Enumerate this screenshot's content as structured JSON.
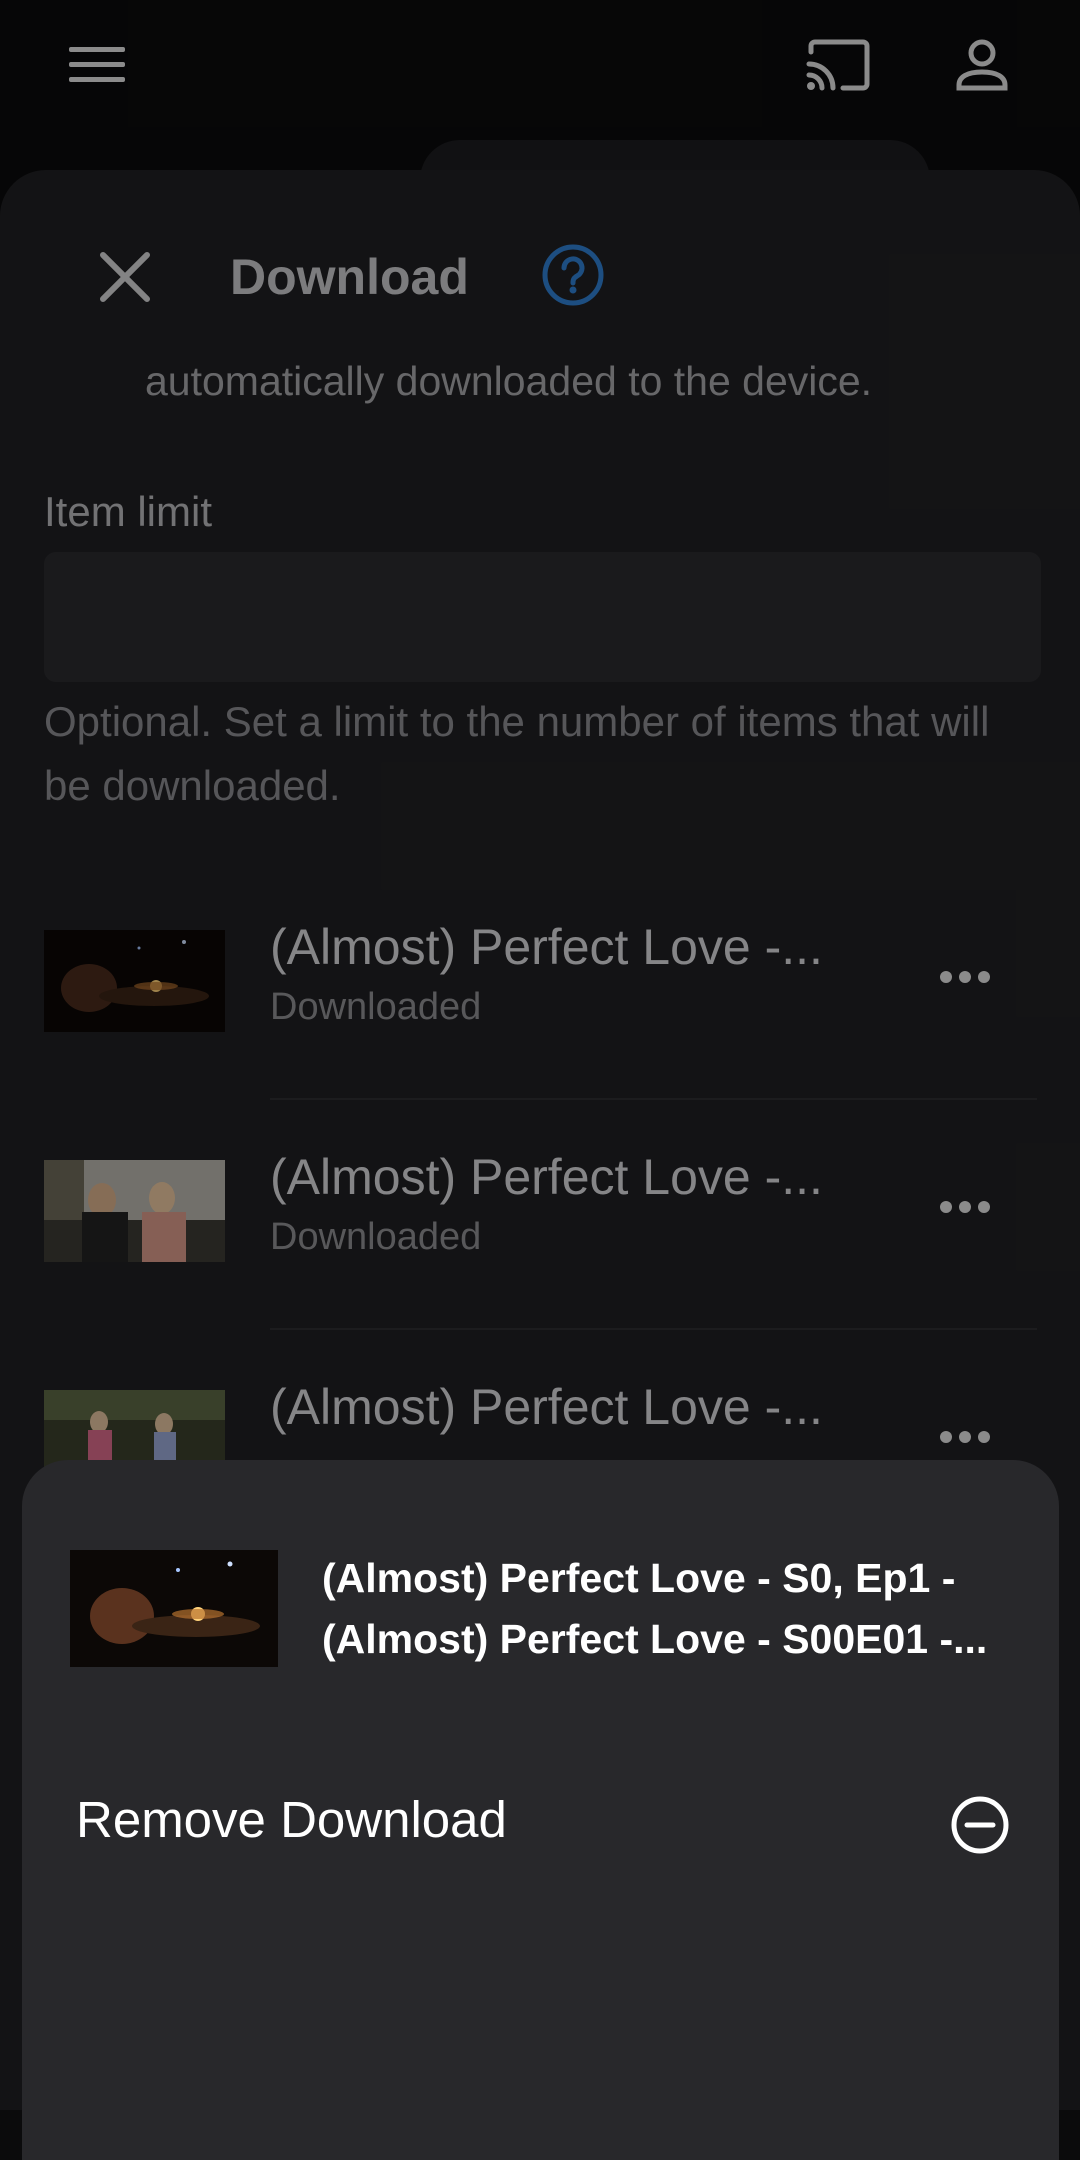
{
  "topbar": {
    "menu_icon": "menu-icon",
    "cast_icon": "cast-icon",
    "account_icon": "account-icon"
  },
  "sheet": {
    "title": "Download",
    "close_icon": "close-icon",
    "help_icon": "help-icon",
    "description_tail": "automatically downloaded to the device.",
    "item_limit": {
      "label": "Item limit",
      "value": "",
      "help": "Optional. Set a limit to the number of items that will be downloaded."
    },
    "items": [
      {
        "title": "(Almost) Perfect Love -...",
        "status": "Downloaded"
      },
      {
        "title": "(Almost) Perfect Love -...",
        "status": "Downloaded"
      },
      {
        "title": "(Almost) Perfect Love -...",
        "status": ""
      }
    ]
  },
  "action_sheet": {
    "title": "(Almost) Perfect Love - S0, Ep1 - (Almost) Perfect Love - S00E01 -...",
    "actions": [
      {
        "label": "Remove Download",
        "icon": "remove-circle-icon"
      }
    ]
  },
  "colors": {
    "accent": "#2f7fd1",
    "sheet_bg": "#202022",
    "action_sheet_bg": "#28282b"
  }
}
